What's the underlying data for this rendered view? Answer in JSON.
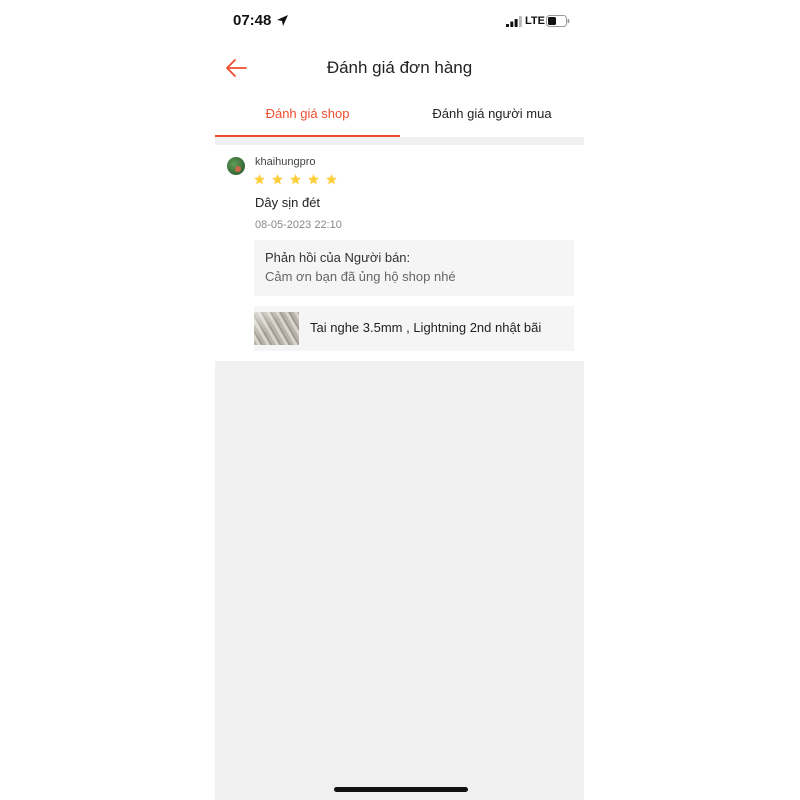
{
  "status_bar": {
    "time": "07:48",
    "network": "LTE",
    "icons": [
      "location-arrow-icon",
      "signal-icon",
      "battery-icon"
    ]
  },
  "header": {
    "title": "Đánh giá đơn hàng",
    "back_icon": "arrow-left-icon"
  },
  "tabs": [
    {
      "label": "Đánh giá shop",
      "active": true
    },
    {
      "label": "Đánh giá người mua",
      "active": false
    }
  ],
  "review": {
    "username": "khaihungpro",
    "rating": 5,
    "comment": "Dây sịn đét",
    "date": "08-05-2023 22:10",
    "seller_reply": {
      "title": "Phản hồi của Người bán:",
      "text": "Cảm ơn bạn đã ủng hộ shop nhé"
    },
    "product": {
      "name": "Tai nghe 3.5mm , Lightning 2nd nhật bãi"
    }
  },
  "colors": {
    "accent": "#ee4d2d",
    "star": "#ffce3d",
    "background_gray": "#f0f0f0",
    "reply_bg": "#f5f5f5"
  }
}
